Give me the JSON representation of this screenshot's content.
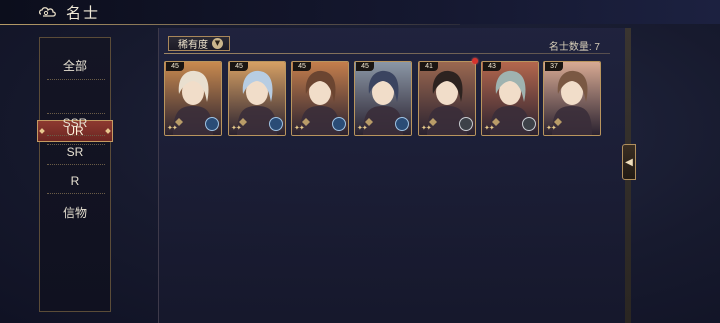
{
  "header": {
    "title": "名士"
  },
  "sidebar": {
    "items": [
      {
        "label": "全部"
      },
      {
        "label": "UR"
      },
      {
        "label": "SSR"
      },
      {
        "label": "SR"
      },
      {
        "label": "R"
      },
      {
        "label": "信物"
      }
    ],
    "active": "UR"
  },
  "filter": {
    "label": "稀有度"
  },
  "count_text": "名士数量: 7",
  "cards": [
    {
      "level": "45",
      "hair": "#e9dfcf",
      "bg": "#c98a4f",
      "badge": "blue-crest"
    },
    {
      "level": "45",
      "hair": "#b7cde3",
      "bg": "#d6a064",
      "badge": "blue-crest"
    },
    {
      "level": "45",
      "hair": "#6b4531",
      "bg": "#c47e4c",
      "badge": "blue-crest"
    },
    {
      "level": "45",
      "hair": "#3b4460",
      "bg": "#8b97a6",
      "badge": "blue-crest"
    },
    {
      "level": "41",
      "hair": "#2d2320",
      "bg": "#9b6850",
      "badge": "silver-crest"
    },
    {
      "level": "43",
      "hair": "#9fb3b0",
      "bg": "#b4674d",
      "badge": "silver-crest"
    },
    {
      "level": "37",
      "hair": "#7a5843",
      "bg": "#d8aa93",
      "badge": "none"
    }
  ],
  "colors": {
    "accent_gold": "#c59b62",
    "active_red": "#8d3a30",
    "background": "#171a2e",
    "notification": "#d8332d"
  }
}
